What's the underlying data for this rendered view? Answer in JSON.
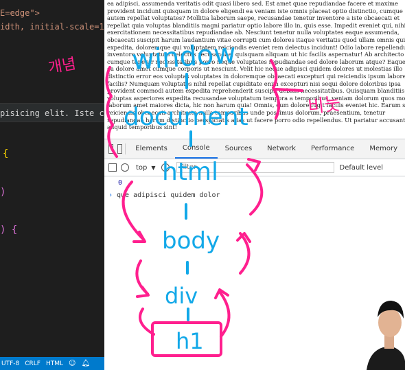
{
  "editor": {
    "lines": [
      {
        "text": "E=edge\">",
        "kind": "string"
      },
      {
        "text": "idth, initial-scale=1.",
        "kind": "string"
      },
      {
        "text": "pisicing elit. Iste cu",
        "kind": "text"
      },
      {
        "text": "{",
        "kind": "brace"
      },
      {
        "text": ")",
        "kind": "brace"
      },
      {
        "text": ") {",
        "kind": "brace"
      }
    ],
    "status": [
      "UTF-8",
      "CRLF",
      "HTML"
    ]
  },
  "page": {
    "lorem": "ea adipisci, assumenda veritatis odit quasi libero sed. Est amet quae repudiandae facere et maxime provident incidunt quisquam in dolore eligendi ea veniam iste omnis placeat optio distinctio, cumque autem repellat voluptates? Mollitia laborum saepe, recusandae tenetur inventore a iste obcaecati et repellat quia voluptas blanditiis magni pariatur optio labore illo in, quis esse. Impedit eveniet qui, nihil exercitationem necessitatibus repudiandae ab. Nesciunt tenetur nulla voluptates eaque assumenda, obcaecati suscipit harum laudantium vitae corrupti cum dolores itaque veritatis quod ullam omnis quis sunt expedita, doloremque qui voluptatem reiciendis eveniet rem delectus incidunt! Odio labore repellendus inventore voluptatum delectus recusandae, quisquam aliquam ut hic facilis aspernatur! Ab architecto cumque tenetur necessitatibus porro neque voluptates repudiandae sed dolore laborum atque? Eaque fuga ea dolore amet cumque corporis ut nesciunt. Velit hic neque adipisci quidem dolores ut molestias illo distinctio error eos voluptas voluptates in doloremque obcaecati excepturi qui reiciendis ipsum labore facilis? Numquam voluptates nihil repellat cupiditate enim excepturi nisi sequi dolore doloribus ipsa provident commodi autem expedita reprehenderit suscipit debitis necessitatibus. Quisquam blanditiis voluptas asperiores expedita recusandae voluptatum tempora a temporibus, veniam dolorum quos modi laborum amet maiores dicta, hic non harum quia! Omnis, eum dolore fugit facilis eveniet hic. Earum sit reiciendis obcaecati architecto nulla temporibus unde possimus dolorum, praesentium, tenetur repudiandae harum distinctio perspiciatis alias ut facere porro odio repellendus. Ut pariatur accusantium aliquid temporibus sint!"
  },
  "devtools": {
    "tabs": [
      "Elements",
      "Console",
      "Sources",
      "Network",
      "Performance",
      "Memory"
    ],
    "active_tab": "Console",
    "context": "top",
    "filter_placeholder": "Filter",
    "levels": "Default level",
    "output": "0",
    "input": "que adipisci quidem dolor"
  },
  "annotations": {
    "korean_left": "개념",
    "korean_right": "비눗",
    "words": [
      "window",
      "document",
      "html",
      "body",
      "div",
      "h1"
    ]
  },
  "colors": {
    "pink": "#ff1f8e",
    "blue": "#12a8e8",
    "vscode_blue": "#007acc",
    "devtools_accent": "#1a73e8"
  }
}
